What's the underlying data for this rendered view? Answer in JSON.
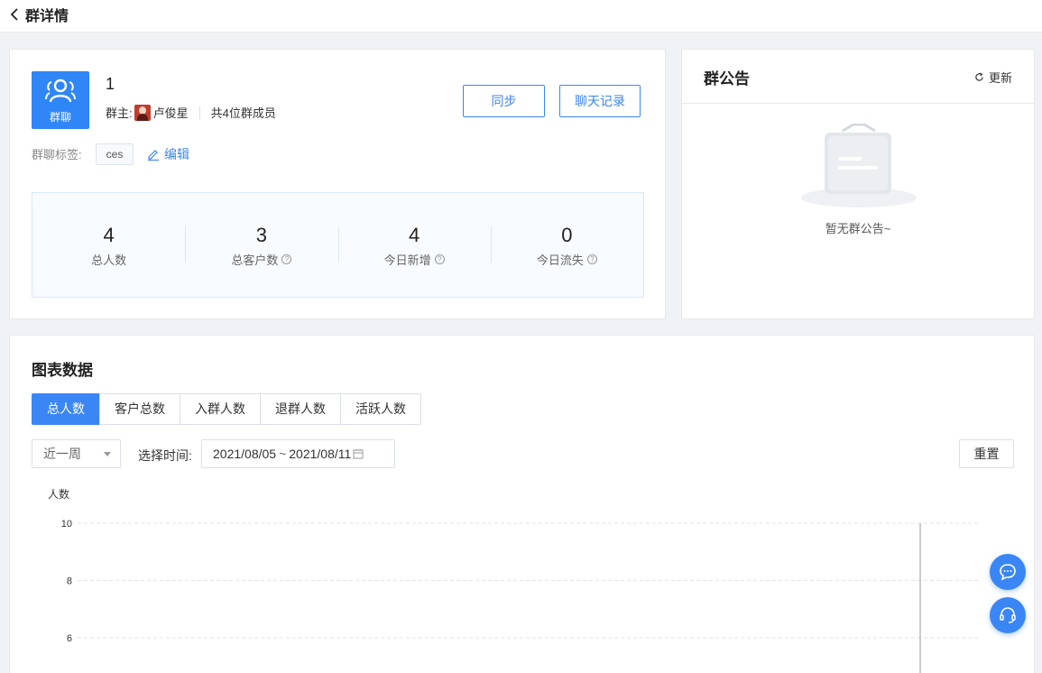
{
  "header": {
    "title": "群详情"
  },
  "group": {
    "avatar_label": "群聊",
    "name": "1",
    "owner_label": "群主:",
    "owner_name": "卢俊星",
    "member_count": "共4位群成员",
    "sync_label": "同步",
    "chat_log_label": "聊天记录",
    "tag_label": "群聊标签:",
    "tag": "ces",
    "edit_label": "编辑"
  },
  "stats": [
    {
      "value": "4",
      "label": "总人数",
      "help": false
    },
    {
      "value": "3",
      "label": "总客户数",
      "help": true
    },
    {
      "value": "4",
      "label": "今日新增",
      "help": true
    },
    {
      "value": "0",
      "label": "今日流失",
      "help": true
    }
  ],
  "notice": {
    "title": "群公告",
    "refresh_label": "更新",
    "empty_text": "暂无群公告~"
  },
  "chart_panel": {
    "title": "图表数据",
    "tabs": [
      "总人数",
      "客户总数",
      "入群人数",
      "退群人数",
      "活跃人数"
    ],
    "active_tab": 0,
    "period": "近一周",
    "time_label": "选择时间:",
    "date_start": "2021/08/05",
    "date_sep": "~",
    "date_end": "2021/08/11",
    "reset_label": "重置"
  },
  "chart_data": {
    "type": "line",
    "ylabel": "人数",
    "y_ticks": [
      10,
      8,
      6
    ],
    "ylim": [
      0,
      10
    ],
    "grid": true,
    "series": []
  },
  "colors": {
    "primary": "#3b86f5",
    "grid": "#e3e3e3"
  },
  "icons": {
    "back": "chevron-left-icon",
    "chat": "chat-bubble-icon",
    "service": "headset-icon"
  }
}
